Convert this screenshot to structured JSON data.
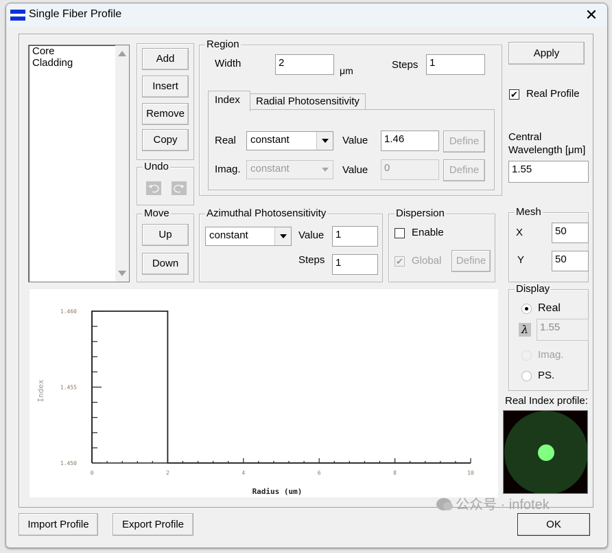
{
  "window": {
    "title": "Single Fiber Profile",
    "close_glyph": "✕"
  },
  "layers": {
    "items": [
      "Core",
      "Cladding"
    ]
  },
  "edit_buttons": {
    "add": "Add",
    "insert": "Insert",
    "remove": "Remove",
    "copy": "Copy"
  },
  "undo": {
    "label": "Undo",
    "undo_icon": "undo-icon",
    "redo_icon": "redo-icon"
  },
  "move": {
    "label": "Move",
    "up": "Up",
    "down": "Down"
  },
  "region": {
    "label": "Region",
    "width_label": "Width",
    "width_value": "2",
    "width_unit": "μm",
    "steps_label": "Steps",
    "steps_value": "1",
    "tabs": [
      {
        "label": "Index",
        "active": true
      },
      {
        "label": "Radial Photosensitivity",
        "active": false
      }
    ],
    "real_label": "Real",
    "real_mode": "constant",
    "real_value_label": "Value",
    "real_value": "1.46",
    "real_define": "Define",
    "imag_label": "Imag.",
    "imag_mode": "constant",
    "imag_value_label": "Value",
    "imag_value": "0",
    "imag_define": "Define"
  },
  "azimuthal": {
    "label": "Azimuthal Photosensitivity",
    "mode": "constant",
    "value_label": "Value",
    "value": "1",
    "steps_label": "Steps",
    "steps": "1"
  },
  "dispersion": {
    "label": "Dispersion",
    "enable_label": "Enable",
    "enable_checked": false,
    "global_label": "Global",
    "global_checked": true,
    "define": "Define"
  },
  "right": {
    "apply": "Apply",
    "real_profile_label": "Real Profile",
    "real_profile_checked": true,
    "check_glyph": "✔",
    "central_wavelength_label_1": "Central",
    "central_wavelength_label_2": "Wavelength [μm]",
    "central_wavelength": "1.55"
  },
  "mesh": {
    "label": "Mesh",
    "x_label": "X",
    "x_value": "50",
    "y_label": "Y",
    "y_value": "50"
  },
  "display": {
    "label": "Display",
    "real": "Real",
    "lambda_glyph": "λ",
    "lambda_value": "1.55",
    "imag": "Imag.",
    "ps": "PS.",
    "selected": "Real"
  },
  "profile_preview": {
    "label": "Real Index profile:",
    "core_color": "#80ff80",
    "cladding_color": "#1a3a1a",
    "background": "#0a0000"
  },
  "footer": {
    "import": "Import Profile",
    "export": "Export Profile",
    "ok": "OK"
  },
  "watermark": {
    "text": "公众号 · infotek"
  },
  "chart_data": {
    "type": "line",
    "title": "",
    "xlabel": "Radius (um)",
    "ylabel": "Index",
    "xlim": [
      0,
      10
    ],
    "ylim": [
      1.45,
      1.46
    ],
    "x_ticks": [
      "0",
      "2",
      "4",
      "6",
      "8",
      "10"
    ],
    "y_ticks": [
      "1.450",
      "1.455",
      "1.460"
    ],
    "series": [
      {
        "name": "Real index",
        "x": [
          0,
          0,
          2,
          2,
          10
        ],
        "y": [
          1.45,
          1.46,
          1.46,
          1.45,
          1.45
        ]
      }
    ],
    "grid": false
  }
}
